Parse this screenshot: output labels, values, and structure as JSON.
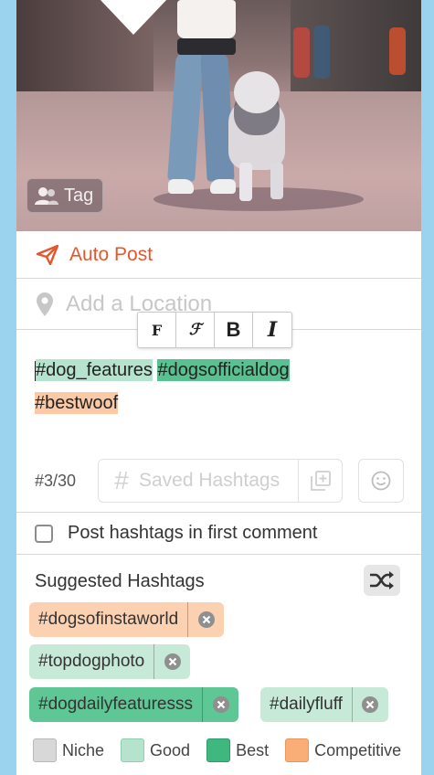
{
  "photo": {
    "tag_label": "Tag"
  },
  "auto_post": {
    "label": "Auto Post"
  },
  "location": {
    "placeholder": "Add a Location"
  },
  "format_toolbar": {
    "buttons": [
      "F",
      "ℱ",
      "B",
      "I"
    ]
  },
  "caption": {
    "hashtags": [
      {
        "text": "#dog_features",
        "category": "good"
      },
      {
        "text": "#dogsofficialdog",
        "category": "best"
      },
      {
        "text": "#bestwoof",
        "category": "competitive"
      }
    ]
  },
  "editor": {
    "counter": "#3/30",
    "saved_hashtags_label": "Saved Hashtags"
  },
  "first_comment": {
    "label": "Post hashtags in first comment",
    "checked": false
  },
  "suggested": {
    "title": "Suggested Hashtags",
    "chips": [
      {
        "text": "#dogsofinstaworld",
        "category": "competitive"
      },
      {
        "text": "#topdogphoto",
        "category": "good"
      },
      {
        "text": "#dogdailyfeaturesss",
        "category": "best"
      },
      {
        "text": "#dailyfluff",
        "category": "good"
      }
    ]
  },
  "legend": {
    "items": [
      {
        "label": "Niche",
        "color": "#d8d8d8"
      },
      {
        "label": "Good",
        "color": "#b5e3cd"
      },
      {
        "label": "Best",
        "color": "#3fb77e"
      },
      {
        "label": "Competitive",
        "color": "#f9ae78"
      }
    ]
  },
  "colors": {
    "accent": "#e4572e",
    "frame": "#9bd3ef"
  }
}
